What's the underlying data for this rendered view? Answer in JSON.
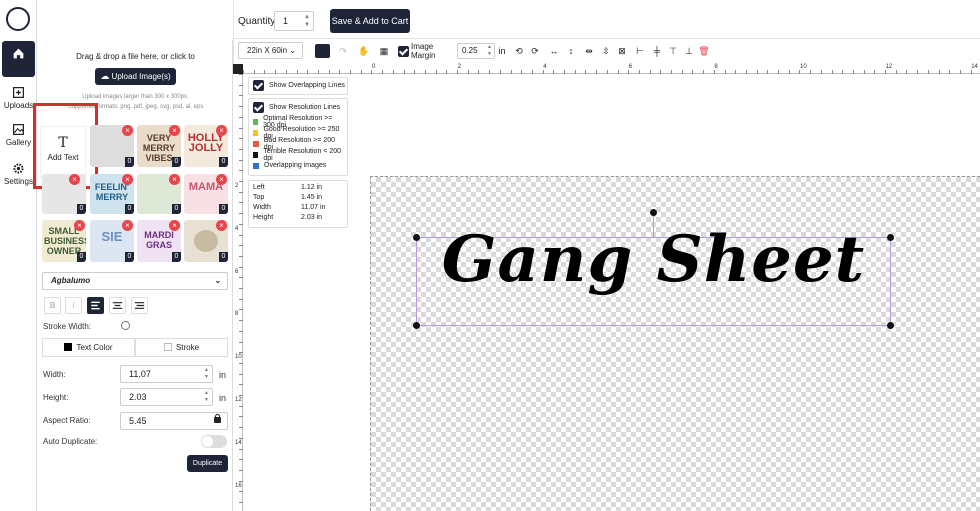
{
  "header": {
    "quantity_label": "Quantity:",
    "quantity_value": "1",
    "cart_button": "Save & Add to Cart"
  },
  "rail": {
    "items": [
      {
        "label": "Home",
        "icon": "home-icon"
      },
      {
        "label": "Uploads",
        "icon": "upload-icon"
      },
      {
        "label": "Gallery",
        "icon": "gallery-icon"
      },
      {
        "label": "Settings",
        "icon": "gear-icon"
      }
    ]
  },
  "upload": {
    "drop_text": "Drag & drop a file here, or click to",
    "button": "Upload Image(s)",
    "hint1": "Upload images larger than 300 x 300px.",
    "hint2": "Supported formats: png, pdf, jpeg, svg, psd, ai, eps"
  },
  "add_text": {
    "label": "Add Text",
    "icon_glyph": "T"
  },
  "thumbnails": [
    {
      "text": "",
      "count": "0"
    },
    {
      "text": "VERY MERRY VIBES",
      "count": "0"
    },
    {
      "text": "HOLLY JOLLY",
      "count": "0"
    },
    {
      "text": "",
      "count": "0"
    },
    {
      "text": "FEELIN' MERRY",
      "count": "0"
    },
    {
      "text": "",
      "count": "0"
    },
    {
      "text": "MAMA",
      "count": "0"
    },
    {
      "text": "SMALL BUSINESS OWNER",
      "count": "0"
    },
    {
      "text": "SIE",
      "count": "0"
    },
    {
      "text": "MARDI GRAS",
      "count": "0"
    },
    {
      "text": "",
      "count": "0"
    }
  ],
  "text_props": {
    "font": "Agbalumo",
    "bold": "B",
    "italic": "I",
    "stroke_width_label": "Stroke Width:",
    "text_color_label": "Text Color",
    "stroke_label": "Stroke",
    "width_label": "Width:",
    "width_value": "11.07",
    "height_label": "Height:",
    "height_value": "2.03",
    "unit": "in",
    "aspect_label": "Aspect Ratio:",
    "aspect_value": "5.45",
    "auto_dup_label": "Auto Duplicate:",
    "duplicate_button": "Duplicate"
  },
  "toolbar": {
    "sheet_size": "22in X 60in",
    "image_margin_label": "Image Margin",
    "image_margin_value": "0.25",
    "image_margin_unit": "in"
  },
  "ruler": {
    "h_numbers": [
      "0",
      "2",
      "4",
      "6",
      "8",
      "10",
      "12",
      "14"
    ],
    "v_numbers": [
      "2",
      "4",
      "6",
      "8",
      "10",
      "12",
      "14",
      "16"
    ]
  },
  "options": {
    "overlap_label": "Show Overlapping Lines",
    "resolution_label": "Show Resolution Lines",
    "legend": [
      {
        "label": "Optimal Resolution >= 300 dpi",
        "color": "#5cb85c"
      },
      {
        "label": "Good Resolution >= 250 dpi",
        "color": "#f0c419"
      },
      {
        "label": "Bad Resolution >= 200 dpi",
        "color": "#e05a47"
      },
      {
        "label": "Terrible Resolution < 200 dpi",
        "color": "#111111"
      },
      {
        "label": "Overlapping images",
        "color": "#2f6fd6"
      }
    ]
  },
  "info": {
    "rows": [
      {
        "label": "Left",
        "value": "1.12 in"
      },
      {
        "label": "Top",
        "value": "1.45 in"
      },
      {
        "label": "Width",
        "value": "11.07 in"
      },
      {
        "label": "Height",
        "value": "2.03 in"
      }
    ]
  },
  "canvas": {
    "text": "Gang Sheet"
  },
  "colors": {
    "navy": "#1e2538",
    "highlight": "#d0312d",
    "delete": "#e8454b"
  }
}
